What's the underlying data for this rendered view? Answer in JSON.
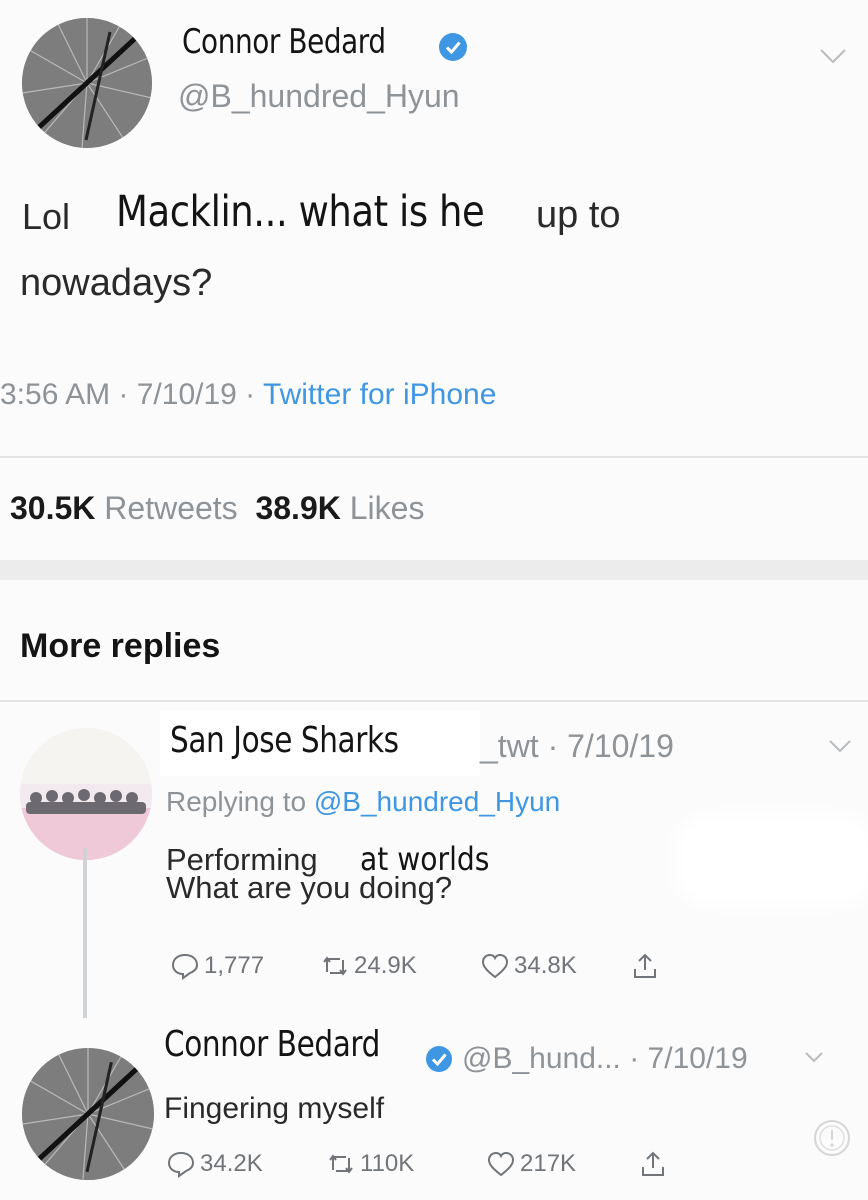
{
  "tweet": {
    "author_name": "Connor Bedard",
    "author_handle": "@B_hundred_Hyun",
    "text_part1": "Lol",
    "text_part2": "Macklin... what is he",
    "text_part3": "up to",
    "text_part4": "nowadays?",
    "time": "3:56 AM",
    "date": "7/10/19",
    "source": "Twitter for iPhone",
    "retweets_count": "30.5K",
    "retweets_label": "Retweets",
    "likes_count": "38.9K",
    "likes_label": "Likes"
  },
  "more_replies_label": "More replies",
  "replies": [
    {
      "author_name": "San Jose Sharks",
      "handle_tail": "_twt · 7/10/19",
      "replying_prefix": "Replying to",
      "replying_handle": "@B_hundred_Hyun",
      "text_part1": "Performing",
      "text_part2": "at worlds",
      "text_line2": "What are you doing?",
      "reply_count": "1,777",
      "retweet_count": "24.9K",
      "like_count": "34.8K"
    },
    {
      "author_name": "Connor Bedard",
      "handle_tail": "@B_hund... · 7/10/19",
      "text": "Fingering myself",
      "reply_count": "34.2K",
      "retweet_count": "110K",
      "like_count": "217K"
    }
  ],
  "icons": {
    "verified": "verified-badge-icon",
    "chevron": "chevron-down-icon",
    "reply": "reply-icon",
    "retweet": "retweet-icon",
    "like": "heart-icon",
    "share": "share-icon",
    "warning": "warning-icon"
  },
  "colors": {
    "link": "#3f97e4",
    "muted": "#8e9398",
    "verified": "#3f97e4"
  }
}
